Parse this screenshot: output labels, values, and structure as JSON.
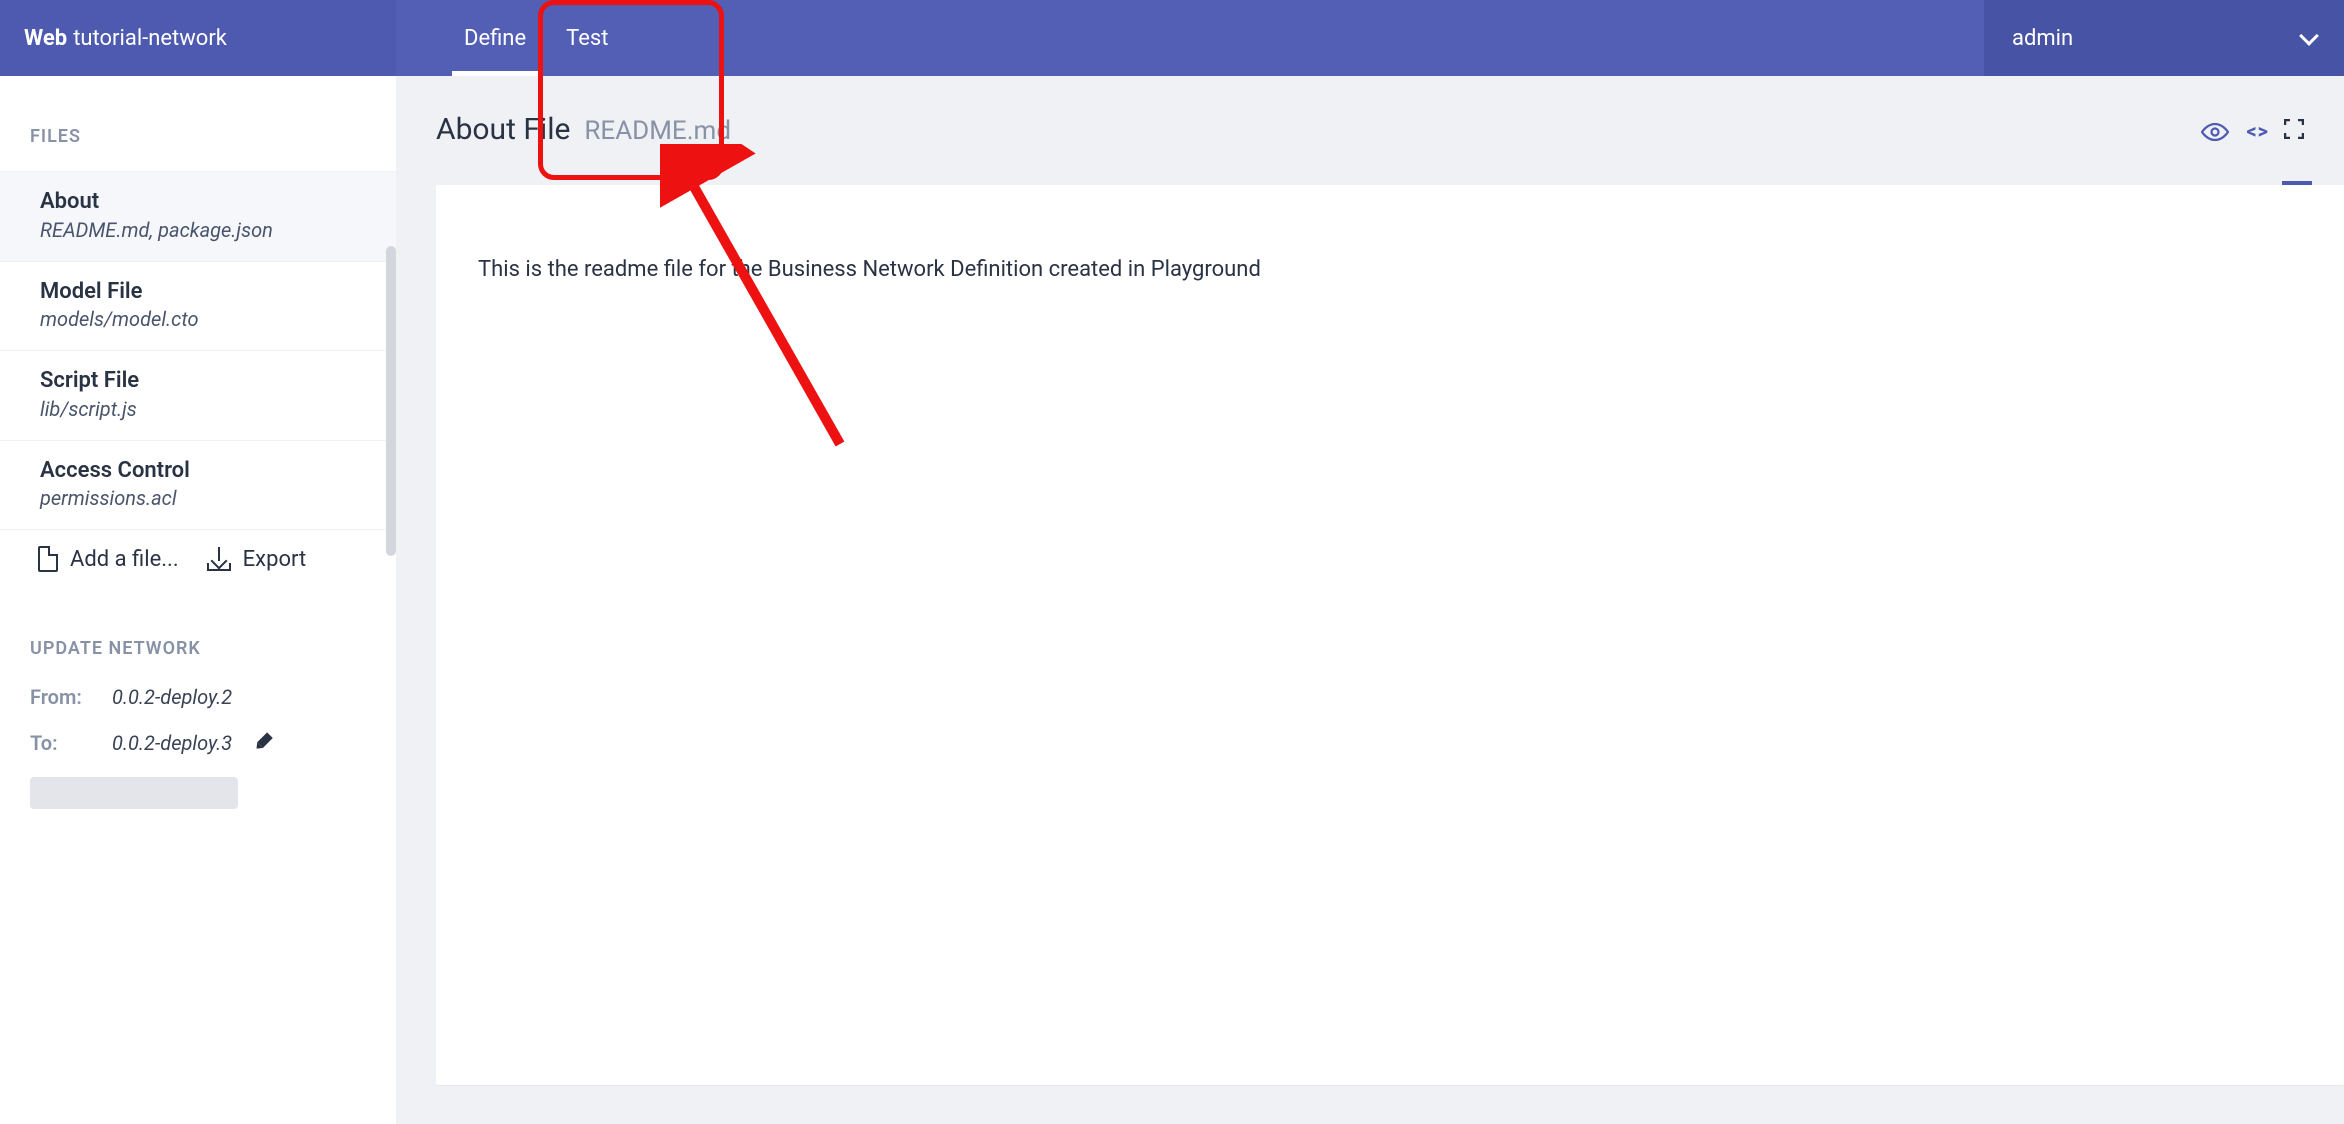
{
  "brand": {
    "label": "Web",
    "name": "tutorial-network"
  },
  "tabs": [
    {
      "label": "Define",
      "active": true
    },
    {
      "label": "Test",
      "active": false
    }
  ],
  "user": {
    "name": "admin"
  },
  "sidebar": {
    "files_heading": "FILES",
    "items": [
      {
        "title": "About",
        "sub": "README.md, package.json",
        "active": true
      },
      {
        "title": "Model File",
        "sub": "models/model.cto",
        "active": false
      },
      {
        "title": "Script File",
        "sub": "lib/script.js",
        "active": false
      },
      {
        "title": "Access Control",
        "sub": "permissions.acl",
        "active": false
      }
    ],
    "add_file_label": "Add a file...",
    "export_label": "Export",
    "update_heading": "UPDATE NETWORK",
    "from_label": "From:",
    "from_value": "0.0.2-deploy.2",
    "to_label": "To:",
    "to_value": "0.0.2-deploy.3"
  },
  "main": {
    "title": "About File",
    "filename": "README.md",
    "content": "This is the readme file for the Business Network Definition created in Playground"
  }
}
